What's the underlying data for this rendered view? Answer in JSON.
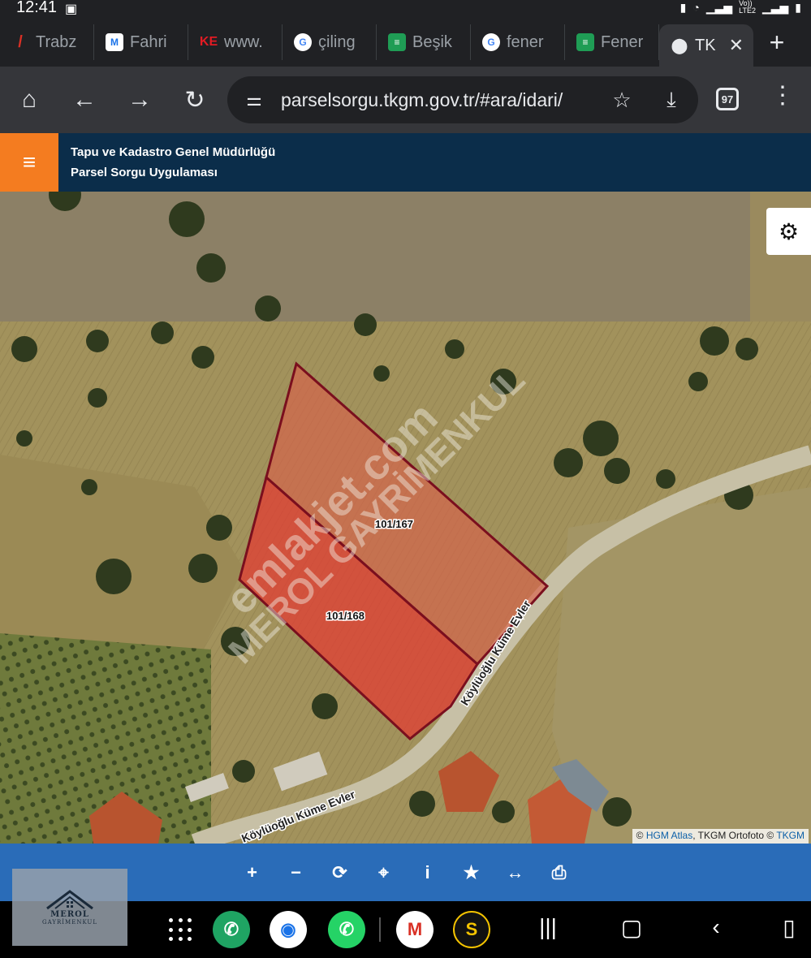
{
  "status_bar": {
    "time": "12:41",
    "network": "LTE2",
    "volte": "Vo))"
  },
  "tabs": [
    {
      "label": "Trabz",
      "icon": "red-slash-icon"
    },
    {
      "label": "Fahri",
      "icon": "m-logo-icon"
    },
    {
      "label": "www.",
      "icon": "ke-logo-icon"
    },
    {
      "label": "çiling",
      "icon": "google-icon"
    },
    {
      "label": "Beşik",
      "icon": "sahibinden-icon"
    },
    {
      "label": "fener",
      "icon": "google-icon"
    },
    {
      "label": "Fener",
      "icon": "sahibinden-icon"
    },
    {
      "label": "TK",
      "icon": "map-pin-icon",
      "active": true
    }
  ],
  "toolbar": {
    "url": "parselsorgu.tkgm.gov.tr/#ara/idari/",
    "tab_count": "97"
  },
  "app": {
    "org_name": "Tapu ve Kadastro Genel Müdürlüğü",
    "app_name": "Parsel Sorgu Uygulaması"
  },
  "map": {
    "parcels": [
      {
        "label": "101/167",
        "fill": "#d9614a"
      },
      {
        "label": "101/168",
        "fill": "#e23c33"
      }
    ],
    "road_label_1": "Köylüoğlu Küme Evler",
    "road_label_2": "Köylüoğlu Küme Evler",
    "watermark_1": "emlakjet.com",
    "watermark_2": "MEROL GAYRİMENKUL",
    "attribution": {
      "prefix": "©",
      "hgm": "HGM Atlas",
      "mid": ", TKGM Ortofoto ©",
      "tkgm": "TKGM"
    }
  },
  "map_tools": [
    "zoom-in-icon",
    "zoom-out-icon",
    "refresh-icon",
    "locate-icon",
    "info-icon",
    "favorite-icon",
    "measure-icon",
    "print-icon"
  ],
  "logo": {
    "name": "MEROL",
    "sub": "GAYRİMENKUL"
  },
  "colors": {
    "header": "#0b2d4a",
    "menu": "#f47c20",
    "tools": "#2a6cb8",
    "parcel_border": "#7a0f1e"
  }
}
